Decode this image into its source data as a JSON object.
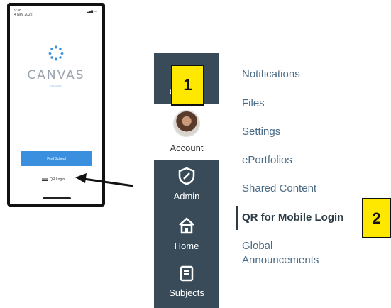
{
  "phone": {
    "status_time": "9:38",
    "status_carrier": "4 Nov 2022",
    "brand": "CANVAS",
    "brand_sub": "STUDENT",
    "find_school_label": "Find School",
    "qr_login_label": "QR Login"
  },
  "nav": {
    "courses_label": "Courses",
    "account_label": "Account",
    "admin_label": "Admin",
    "home_label": "Home",
    "subjects_label": "Subjects"
  },
  "menu": {
    "items": [
      "Notifications",
      "Files",
      "Settings",
      "ePortfolios",
      "Shared Content",
      "QR for Mobile Login",
      "Global",
      "Announcements"
    ]
  },
  "callouts": {
    "step1": "1",
    "step2": "2"
  },
  "colors": {
    "nav_bg": "#394b58",
    "badge_yellow": "#ffe800",
    "button_blue": "#3a90de",
    "menu_link": "#4a6b86"
  }
}
